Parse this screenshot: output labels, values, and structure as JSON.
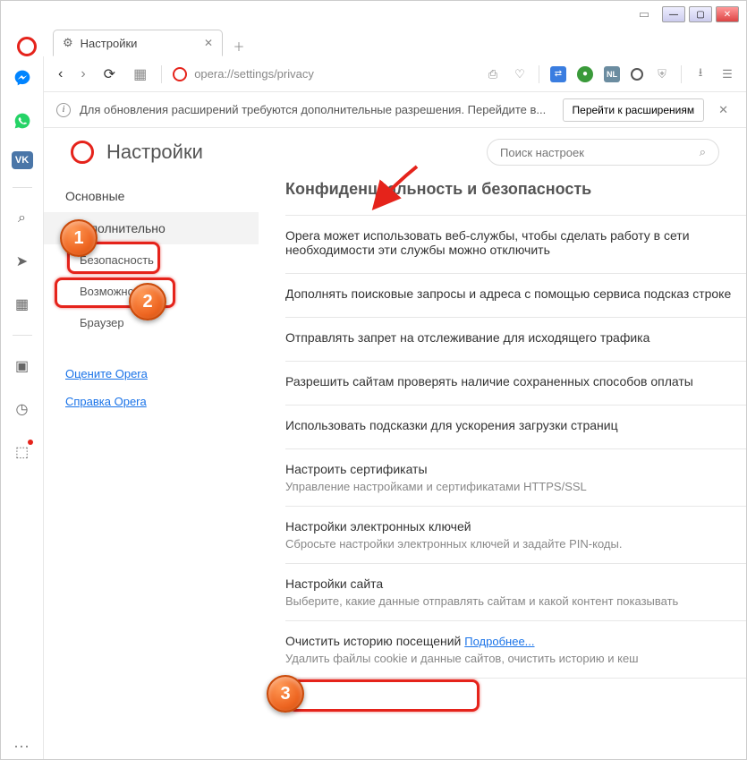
{
  "tab": {
    "title": "Настройки"
  },
  "addressbar": {
    "url": "opera://settings/privacy",
    "nl_badge": "NL"
  },
  "infobar": {
    "text": "Для обновления расширений требуются дополнительные разрешения. Перейдите в...",
    "button": "Перейти к расширениям"
  },
  "settings_header": {
    "title": "Настройки",
    "search_placeholder": "Поиск настроек"
  },
  "sidebar_nav": {
    "basic": "Основные",
    "advanced": "Дополнительно",
    "security": "Безопасность",
    "features": "Возможности",
    "browser": "Браузер",
    "rate": "Оцените Opera",
    "help": "Справка Opera"
  },
  "section": {
    "heading": "Конфиденциальность и безопасность",
    "rows": [
      {
        "title": "Opera может использовать веб-службы, чтобы сделать работу в сети необходимости эти службы можно отключить",
        "desc": ""
      },
      {
        "title": "Дополнять поисковые запросы и адреса с помощью сервиса подсказ строке",
        "desc": ""
      },
      {
        "title": "Отправлять запрет на отслеживание для исходящего трафика",
        "desc": ""
      },
      {
        "title": "Разрешить сайтам проверять наличие сохраненных способов оплаты",
        "desc": ""
      },
      {
        "title": "Использовать подсказки для ускорения загрузки страниц",
        "desc": ""
      },
      {
        "title": "Настроить сертификаты",
        "desc": "Управление настройками и сертификатами HTTPS/SSL"
      },
      {
        "title": "Настройки электронных ключей",
        "desc": "Сбросьте настройки электронных ключей и задайте PIN-коды."
      },
      {
        "title": "Настройки сайта",
        "desc": "Выберите, какие данные отправлять сайтам и какой контент показывать"
      },
      {
        "title": "Очистить историю посещений",
        "desc": "Удалить файлы cookie и данные сайтов, очистить историю и кеш",
        "link": "Подробнее..."
      }
    ]
  },
  "annotations": {
    "one": "1",
    "two": "2",
    "three": "3"
  }
}
